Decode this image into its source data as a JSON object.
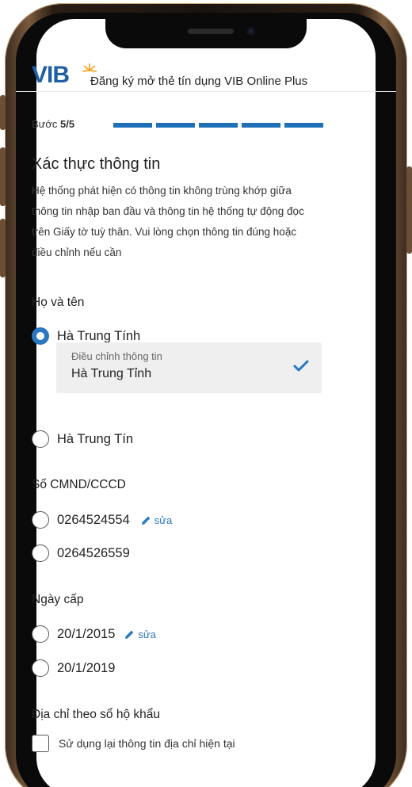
{
  "header": {
    "logo_text": "VIB",
    "title": "Đăng ký mở thẻ tín dụng VIB Online Plus"
  },
  "step": {
    "prefix": "Bước",
    "value": "5/5",
    "current": 5,
    "total": 5
  },
  "page": {
    "title": "Xác thực thông tin",
    "description": "Hệ thống phát hiện có thông tin không trùng khớp giữa thông tin nhập ban đầu và thông tin hệ thống tự động đọc trên Giấy tờ tuỳ thân. Vui lòng chọn thông tin đúng hoặc điều chỉnh nếu cần"
  },
  "full_name": {
    "label": "Họ và tên",
    "option_1": "Hà Trung Tính",
    "adjust_label": "Điều chỉnh thông tin",
    "adjust_value": "Hà Trung Tỉnh",
    "option_2": "Hà Trung Tín"
  },
  "id_number": {
    "label": "Số CMND/CCCD",
    "option_1": "0264524554",
    "edit_label": "sửa",
    "option_2": "0264526559"
  },
  "issue_date": {
    "label": "Ngày cấp",
    "option_1": "20/1/2015",
    "edit_label": "sửa",
    "option_2": "20/1/2019"
  },
  "address": {
    "label": "Địa chỉ theo sổ hộ khẩu",
    "reuse_label": "Sử dụng lại thông tin địa chỉ hiện tại"
  },
  "colors": {
    "brand_blue": "#1f5fa8",
    "accent_blue": "#2a78c2",
    "logo_star": "#f5a623"
  },
  "icons": {
    "edit": "pencil-icon",
    "selected": "checkmark-icon"
  }
}
